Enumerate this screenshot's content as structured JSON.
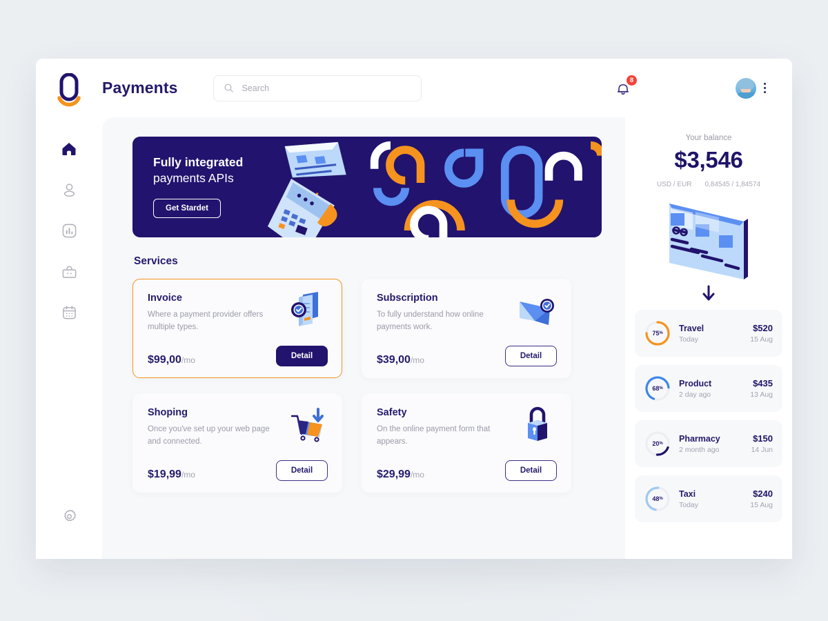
{
  "app": {
    "brand_title": "Payments",
    "logo_icon": "zero-logo-icon"
  },
  "search": {
    "placeholder": "Search",
    "value": "",
    "icon": "search-icon"
  },
  "topbar": {
    "notification_icon": "bell-icon",
    "notification_count": "8",
    "avatar_icon": "user-avatar",
    "menu_icon": "kebab-menu-icon"
  },
  "sidebar": {
    "items": [
      {
        "name": "home",
        "icon": "home-icon",
        "active": true
      },
      {
        "name": "profile",
        "icon": "user-icon",
        "active": false
      },
      {
        "name": "analytics",
        "icon": "bar-chart-icon",
        "active": false
      },
      {
        "name": "wallet",
        "icon": "bag-icon",
        "active": false
      },
      {
        "name": "calendar",
        "icon": "calendar-icon",
        "active": false
      }
    ],
    "settings": {
      "name": "settings",
      "icon": "gear-icon"
    }
  },
  "hero": {
    "title_line1": "Fully integrated",
    "title_line2": "payments APIs",
    "button_label": "Get Stardet",
    "bg_color": "#22136e"
  },
  "services": {
    "heading": "Services",
    "cards": [
      {
        "title": "Invoice",
        "desc": "Where a payment provider offers multiple types.",
        "price": "$99,00",
        "period": "/mo",
        "button": "Detail",
        "selected": true,
        "illustration": "invoice-document-icon"
      },
      {
        "title": "Subscription",
        "desc": "To fully understand how online payments work.",
        "price": "$39,00",
        "period": "/mo",
        "button": "Detail",
        "selected": false,
        "illustration": "envelope-check-icon"
      },
      {
        "title": "Shoping",
        "desc": "Once you've set up your web page and connected.",
        "price": "$19,99",
        "period": "/mo",
        "button": "Detail",
        "selected": false,
        "illustration": "shopping-cart-icon"
      },
      {
        "title": "Safety",
        "desc": "On the online payment form that appears.",
        "price": "$29,99",
        "period": "/mo",
        "button": "Detail",
        "selected": false,
        "illustration": "padlock-icon"
      }
    ]
  },
  "balance": {
    "label": "Your balance",
    "amount": "$3,546",
    "pair_label": "USD / EUR",
    "pair_value": "0,84545 / 1,84574",
    "card_illustration": "credit-card-icon",
    "download_icon": "arrow-down-icon"
  },
  "transactions": [
    {
      "name": "Travel",
      "when": "Today",
      "amount": "$520",
      "date": "15 Aug",
      "percent": 75,
      "percent_label": "75",
      "color": "#f5931e"
    },
    {
      "name": "Product",
      "when": "2 day ago",
      "amount": "$435",
      "date": "13 Aug",
      "percent": 68,
      "percent_label": "68",
      "color": "#3c87e8"
    },
    {
      "name": "Pharmacy",
      "when": "2 month ago",
      "amount": "$150",
      "date": "14 Jun",
      "percent": 20,
      "percent_label": "20",
      "color": "#1e1368"
    },
    {
      "name": "Taxi",
      "when": "Today",
      "amount": "$240",
      "date": "15 Aug",
      "percent": 48,
      "percent_label": "48",
      "color": "#9fc9f0"
    }
  ],
  "colors": {
    "navy": "#22136e",
    "orange": "#f5931e",
    "blue": "#3c87e8",
    "page_bg": "#e9edf1",
    "canvas_bg": "#f7f8fa"
  }
}
